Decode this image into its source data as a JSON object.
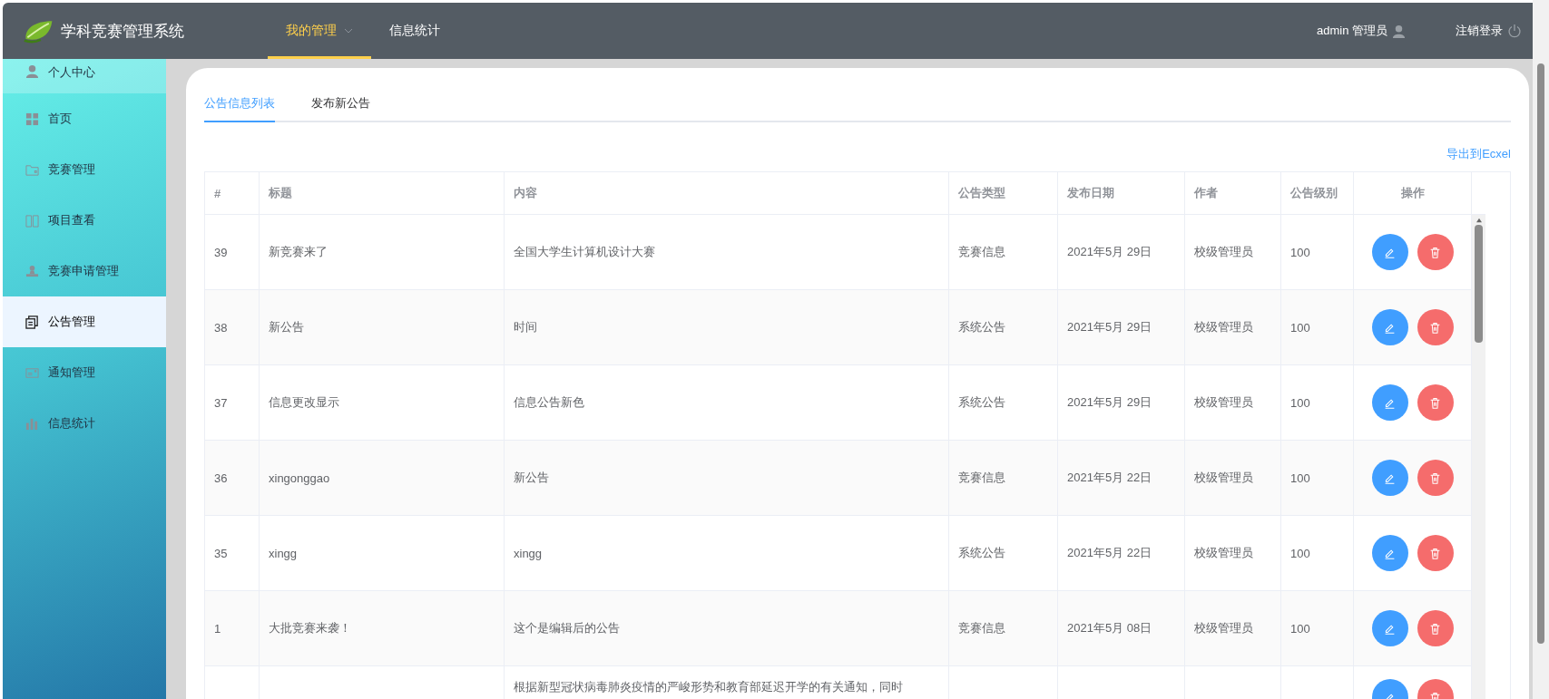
{
  "header": {
    "title": "学科竞赛管理系统",
    "nav": [
      {
        "label": "我的管理",
        "selected": true,
        "dropdown": true
      },
      {
        "label": "信息统计",
        "selected": false,
        "dropdown": false
      }
    ],
    "user": "admin 管理员",
    "logout": "注销登录"
  },
  "sidebar": {
    "items": [
      {
        "label": "个人中心",
        "selected": false
      },
      {
        "label": "首页",
        "selected": false
      },
      {
        "label": "竞赛管理",
        "selected": false
      },
      {
        "label": "项目查看",
        "selected": false
      },
      {
        "label": "竞赛申请管理",
        "selected": false
      },
      {
        "label": "公告管理",
        "selected": true
      },
      {
        "label": "通知管理",
        "selected": false
      },
      {
        "label": "信息统计",
        "selected": false
      }
    ]
  },
  "tabs": [
    {
      "label": "公告信息列表",
      "selected": true
    },
    {
      "label": "发布新公告",
      "selected": false
    }
  ],
  "export_link": "导出到Ecxel",
  "table": {
    "columns": [
      "#",
      "标题",
      "内容",
      "公告类型",
      "发布日期",
      "作者",
      "公告级别",
      "操作"
    ],
    "rows": [
      {
        "id": "39",
        "title": "新竞赛来了",
        "content": "全国大学生计算机设计大赛",
        "type": "竞赛信息",
        "date": "2021年5月 29日",
        "author": "校级管理员",
        "level": "100"
      },
      {
        "id": "38",
        "title": "新公告",
        "content": "时间",
        "type": "系统公告",
        "date": "2021年5月 29日",
        "author": "校级管理员",
        "level": "100"
      },
      {
        "id": "37",
        "title": "信息更改显示",
        "content": "信息公告新色",
        "type": "系统公告",
        "date": "2021年5月 29日",
        "author": "校级管理员",
        "level": "100"
      },
      {
        "id": "36",
        "title": "xingonggao",
        "content": "新公告",
        "type": "竞赛信息",
        "date": "2021年5月 22日",
        "author": "校级管理员",
        "level": "100"
      },
      {
        "id": "35",
        "title": "xingg",
        "content": "xingg",
        "type": "系统公告",
        "date": "2021年5月 22日",
        "author": "校级管理员",
        "level": "100"
      },
      {
        "id": "1",
        "title": "大批竞赛来袭！",
        "content": "这个是编辑后的公告",
        "type": "竞赛信息",
        "date": "2021年5月 08日",
        "author": "校级管理员",
        "level": "100"
      },
      {
        "id": "",
        "title": "",
        "content": "根据新型冠状病毒肺炎疫情的严峻形势和教育部延迟开学的有关通知，同时",
        "type": "",
        "date": "",
        "author": "",
        "level": ""
      }
    ]
  }
}
